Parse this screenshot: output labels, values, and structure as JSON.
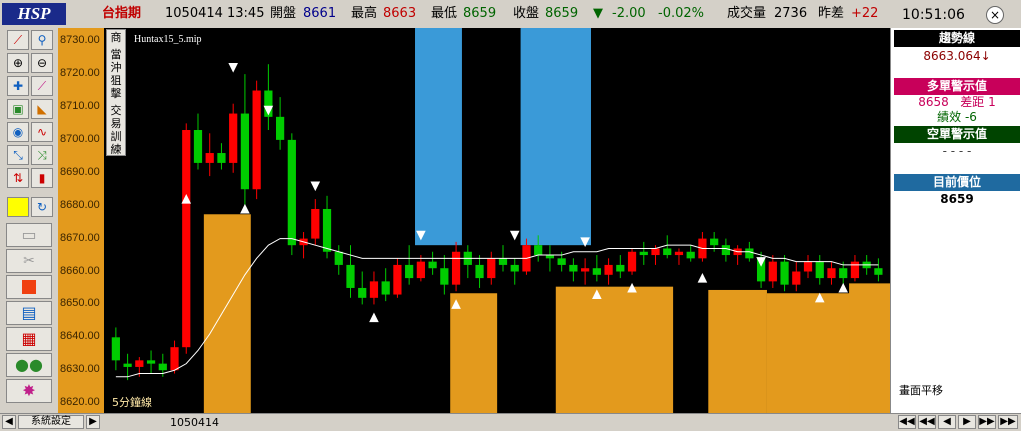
{
  "header": {
    "logo": "HSP",
    "index_name": "台指期",
    "date": "1050414",
    "time": "13:45",
    "open_label": "開盤",
    "open_value": "8661",
    "high_label": "最高",
    "high_value": "8663",
    "low_label": "最低",
    "low_value": "8659",
    "close_label": "收盤",
    "close_value": "8659",
    "change_arrow": "▼",
    "change_value": "-2.00",
    "change_pct": "-0.02%",
    "volume_label": "成交量",
    "volume_value": "2736",
    "diff_label": "昨差",
    "diff_value": "+22",
    "clock": "10:51:06",
    "close_icon": "×"
  },
  "side_menu": {
    "items": [
      "商",
      "當沖狙擊",
      "交易訓練"
    ]
  },
  "chart": {
    "file_label": "Huntax15_5.mip",
    "period_label": "5分鐘線",
    "date_label": "1050414"
  },
  "right_panel": {
    "trend_title": "趨勢線",
    "trend_value": "8663.064↓",
    "long_title": "多單警示值",
    "long_value": "8658",
    "gap_label": "差距",
    "gap_value": "1",
    "perf_label": "績效",
    "perf_value": "-6",
    "short_title": "空單警示值",
    "short_value": "- - - -",
    "pos_title": "目前價位",
    "pos_value": "8659",
    "footer": "畫面平移"
  },
  "status": {
    "settings": "系統設定",
    "date": "1050414"
  },
  "nav_buttons": [
    "◀◀",
    "◀◀",
    "◀",
    "▶",
    "▶▶",
    "▶▶"
  ],
  "colors": {
    "up": "#ff0000",
    "down": "#00cc00",
    "orange_zone": "#e39a1d",
    "blue_zone": "#3a9ad8",
    "trend_title_bg": "#000000",
    "long_title_bg": "#c8005a",
    "short_title_bg": "#004400",
    "pos_title_bg": "#1f6aa0"
  },
  "chart_data": {
    "type": "candlestick",
    "ylim": [
      8617,
      8734
    ],
    "yticks": [
      8730,
      8720,
      8710,
      8700,
      8690,
      8680,
      8670,
      8660,
      8650,
      8640,
      8630,
      8620
    ],
    "candles": [
      [
        8640,
        8643,
        8630,
        8633
      ],
      [
        8632,
        8635,
        8627,
        8631
      ],
      [
        8631,
        8634,
        8628,
        8633
      ],
      [
        8633,
        8636,
        8629,
        8632
      ],
      [
        8632,
        8635,
        8628,
        8630
      ],
      [
        8630,
        8639,
        8629,
        8637
      ],
      [
        8637,
        8705,
        8635,
        8703
      ],
      [
        8703,
        8708,
        8691,
        8693
      ],
      [
        8693,
        8702,
        8689,
        8696
      ],
      [
        8696,
        8699,
        8691,
        8693
      ],
      [
        8693,
        8711,
        8690,
        8708
      ],
      [
        8708,
        8720,
        8678,
        8685
      ],
      [
        8685,
        8718,
        8682,
        8715
      ],
      [
        8715,
        8723,
        8703,
        8707
      ],
      [
        8707,
        8713,
        8697,
        8700
      ],
      [
        8700,
        8702,
        8665,
        8668
      ],
      [
        8668,
        8672,
        8664,
        8670
      ],
      [
        8670,
        8682,
        8668,
        8679
      ],
      [
        8679,
        8683,
        8664,
        8666
      ],
      [
        8666,
        8668,
        8659,
        8662
      ],
      [
        8662,
        8668,
        8652,
        8655
      ],
      [
        8655,
        8660,
        8650,
        8652
      ],
      [
        8652,
        8660,
        8650,
        8657
      ],
      [
        8657,
        8661,
        8651,
        8653
      ],
      [
        8653,
        8664,
        8652,
        8662
      ],
      [
        8662,
        8668,
        8656,
        8658
      ],
      [
        8658,
        8665,
        8657,
        8663
      ],
      [
        8663,
        8666,
        8659,
        8661
      ],
      [
        8661,
        8665,
        8653,
        8656
      ],
      [
        8656,
        8669,
        8654,
        8666
      ],
      [
        8666,
        8668,
        8658,
        8662
      ],
      [
        8662,
        8665,
        8655,
        8658
      ],
      [
        8658,
        8666,
        8656,
        8664
      ],
      [
        8664,
        8668,
        8660,
        8662
      ],
      [
        8662,
        8664,
        8656,
        8660
      ],
      [
        8660,
        8670,
        8659,
        8668
      ],
      [
        8668,
        8671,
        8663,
        8665
      ],
      [
        8665,
        8668,
        8660,
        8664
      ],
      [
        8664,
        8666,
        8660,
        8662
      ],
      [
        8662,
        8664,
        8657,
        8660
      ],
      [
        8660,
        8664,
        8656,
        8661
      ],
      [
        8661,
        8665,
        8657,
        8659
      ],
      [
        8659,
        8664,
        8656,
        8662
      ],
      [
        8662,
        8665,
        8658,
        8660
      ],
      [
        8660,
        8667,
        8659,
        8666
      ],
      [
        8666,
        8669,
        8662,
        8665
      ],
      [
        8665,
        8668,
        8662,
        8667
      ],
      [
        8667,
        8671,
        8664,
        8665
      ],
      [
        8665,
        8667,
        8662,
        8666
      ],
      [
        8666,
        8668,
        8663,
        8664
      ],
      [
        8664,
        8672,
        8663,
        8670
      ],
      [
        8670,
        8672,
        8666,
        8668
      ],
      [
        8668,
        8670,
        8663,
        8665
      ],
      [
        8665,
        8668,
        8662,
        8667
      ],
      [
        8667,
        8669,
        8663,
        8664
      ],
      [
        8664,
        8666,
        8655,
        8657
      ],
      [
        8657,
        8665,
        8655,
        8663
      ],
      [
        8663,
        8665,
        8654,
        8656
      ],
      [
        8656,
        8663,
        8654,
        8660
      ],
      [
        8660,
        8665,
        8658,
        8663
      ],
      [
        8663,
        8665,
        8656,
        8658
      ],
      [
        8658,
        8663,
        8656,
        8661
      ],
      [
        8661,
        8663,
        8656,
        8658
      ],
      [
        8658,
        8665,
        8657,
        8663
      ],
      [
        8663,
        8665,
        8659,
        8661
      ],
      [
        8661,
        8664,
        8657,
        8659
      ]
    ],
    "ma": [
      8628,
      8628,
      8629,
      8629,
      8629,
      8630,
      8632,
      8636,
      8641,
      8647,
      8653,
      8659,
      8664,
      8668,
      8670,
      8670,
      8669,
      8668,
      8667,
      8666,
      8665,
      8664,
      8664,
      8664,
      8664,
      8664,
      8664,
      8664,
      8664,
      8664,
      8664,
      8664,
      8664,
      8664,
      8664,
      8664,
      8665,
      8665,
      8665,
      8666,
      8666,
      8666,
      8667,
      8667,
      8667,
      8667,
      8667,
      8668,
      8668,
      8668,
      8667,
      8667,
      8667,
      8666,
      8666,
      8665,
      8664,
      8664,
      8663,
      8663,
      8663,
      8663,
      8662,
      8662,
      8662,
      8662
    ]
  }
}
